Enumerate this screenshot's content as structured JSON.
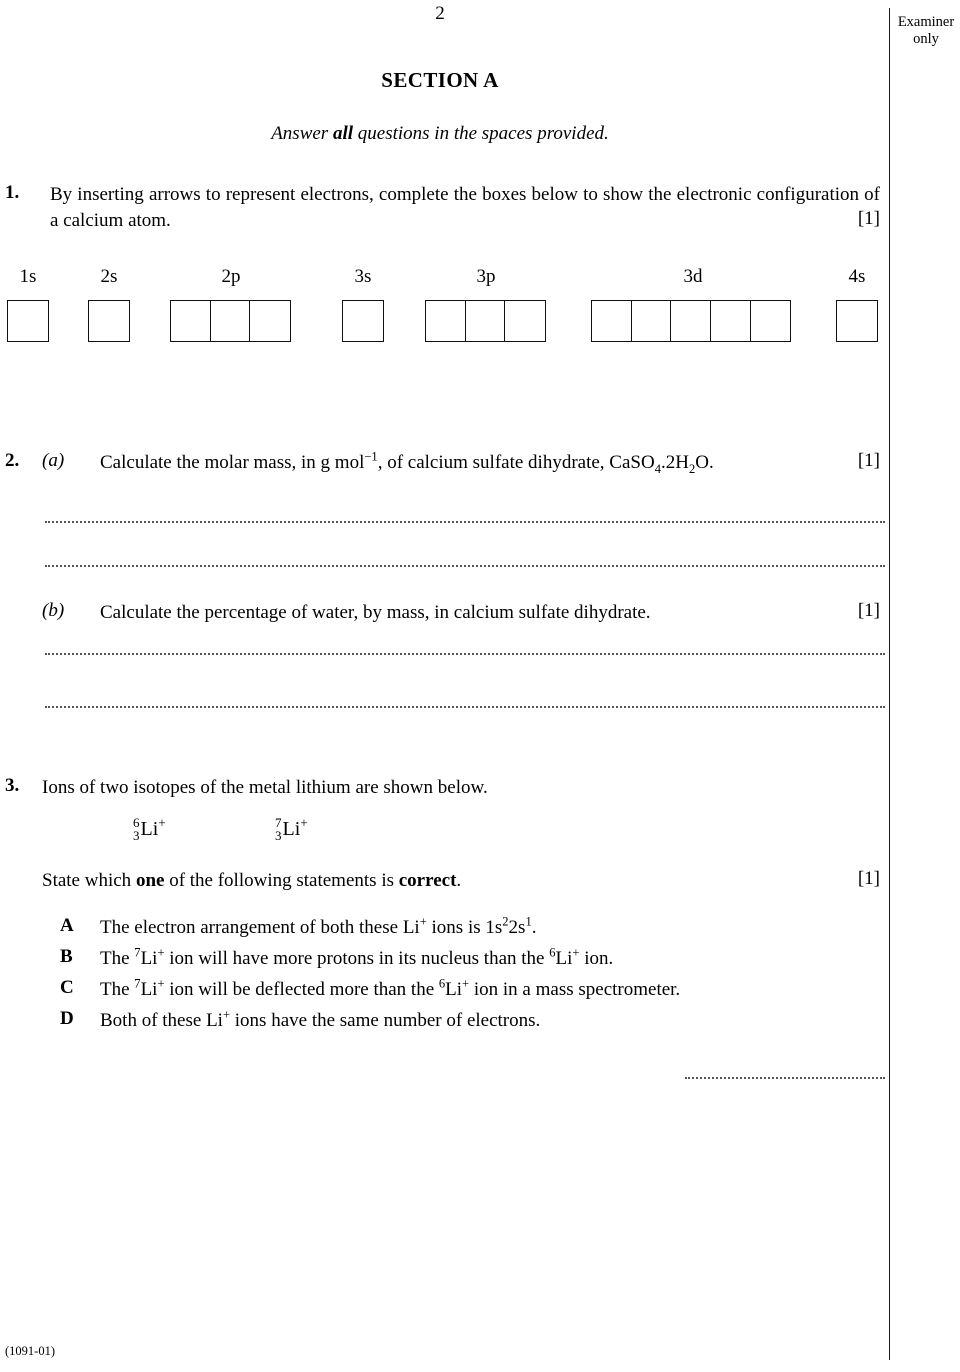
{
  "page": {
    "number": "2",
    "footer_code": "(1091-01)"
  },
  "examiner": {
    "label_line1": "Examiner",
    "label_line2": "only"
  },
  "headings": {
    "section_title": "SECTION A",
    "instruction_pre": "Answer ",
    "instruction_bold": "all",
    "instruction_post": " questions in the spaces provided."
  },
  "questions": [
    {
      "number": "1.",
      "text": "By inserting arrows to represent electrons, complete the boxes below to show the electronic configuration of a calcium atom.",
      "marks": "[1]"
    },
    {
      "number": "2.",
      "parts": [
        {
          "label": "(a)",
          "text_pre": "Calculate the molar mass, in g mol",
          "text_sup": "−1",
          "text_mid": ", of calcium sulfate dihydrate, CaSO",
          "sub1": "4",
          "text_mid2": ".2H",
          "sub2": "2",
          "text_end": "O.",
          "marks": "[1]"
        },
        {
          "label": "(b)",
          "text": "Calculate the percentage of water, by mass, in calcium sulfate dihydrate.",
          "marks": "[1]"
        }
      ]
    },
    {
      "number": "3.",
      "text": "Ions of two isotopes of the metal lithium are shown below.",
      "isotopes": [
        {
          "mass_number": "6",
          "atomic_number": "3",
          "symbol": "Li",
          "charge": "+"
        },
        {
          "mass_number": "7",
          "atomic_number": "3",
          "symbol": "Li",
          "charge": "+"
        }
      ],
      "prompt_pre": "State which ",
      "prompt_bold1": "one",
      "prompt_mid": " of the following statements is ",
      "prompt_bold2": "correct",
      "prompt_end": ".",
      "marks": "[1]",
      "options": [
        {
          "letter": "A",
          "segments": [
            {
              "t": "The electron arrangement of both these Li"
            },
            {
              "t": "+",
              "sup": true
            },
            {
              "t": " ions is 1s"
            },
            {
              "t": "2",
              "sup": true
            },
            {
              "t": "2s"
            },
            {
              "t": "1",
              "sup": true
            },
            {
              "t": "."
            }
          ]
        },
        {
          "letter": "B",
          "segments": [
            {
              "t": "The "
            },
            {
              "t": "7",
              "sup": true
            },
            {
              "t": "Li"
            },
            {
              "t": "+",
              "sup": true
            },
            {
              "t": " ion will have more protons in its nucleus than the "
            },
            {
              "t": "6",
              "sup": true
            },
            {
              "t": "Li"
            },
            {
              "t": "+",
              "sup": true
            },
            {
              "t": " ion."
            }
          ]
        },
        {
          "letter": "C",
          "segments": [
            {
              "t": "The "
            },
            {
              "t": "7",
              "sup": true
            },
            {
              "t": "Li"
            },
            {
              "t": "+",
              "sup": true
            },
            {
              "t": " ion will be deflected more than the "
            },
            {
              "t": "6",
              "sup": true
            },
            {
              "t": "Li"
            },
            {
              "t": "+",
              "sup": true
            },
            {
              "t": " ion in a mass spectrometer."
            }
          ]
        },
        {
          "letter": "D",
          "segments": [
            {
              "t": "Both of these Li"
            },
            {
              "t": "+",
              "sup": true
            },
            {
              "t": " ions have the same number of electrons."
            }
          ]
        }
      ]
    }
  ],
  "orbitals": [
    {
      "label": "1s",
      "boxes": 1
    },
    {
      "label": "2s",
      "boxes": 1
    },
    {
      "label": "2p",
      "boxes": 3
    },
    {
      "label": "3s",
      "boxes": 1
    },
    {
      "label": "3p",
      "boxes": 3
    },
    {
      "label": "3d",
      "boxes": 5
    },
    {
      "label": "4s",
      "boxes": 1
    }
  ],
  "colors": {
    "ink": "#000000",
    "rule": "#1a1a1a",
    "dots": "#555555"
  }
}
